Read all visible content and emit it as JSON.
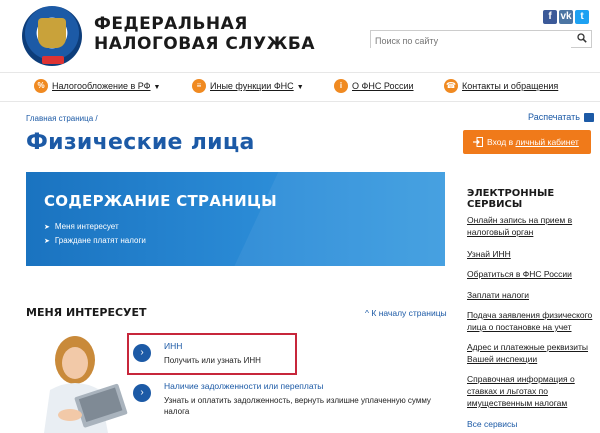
{
  "brand": {
    "line1": "ФЕДЕРАЛЬНАЯ",
    "line2": "НАЛОГОВАЯ СЛУЖБА"
  },
  "social": {
    "fb": "f",
    "vk": "vk",
    "tw": "t"
  },
  "search": {
    "placeholder": "Поиск по сайту"
  },
  "nav": {
    "items": [
      {
        "label": "Налогообложение в РФ",
        "icon": "%"
      },
      {
        "label": "Иные функции ФНС",
        "icon": "≡"
      },
      {
        "label": "О ФНС России",
        "icon": "i"
      },
      {
        "label": "Контакты и обращения",
        "icon": "☎"
      }
    ]
  },
  "breadcrumb": "Главная страница",
  "print_label": "Распечатать",
  "page_title": "Физические лица",
  "cabinet": {
    "prefix": "Вход в",
    "link": "личный кабинет"
  },
  "banner": {
    "title": "СОДЕРЖАНИЕ СТРАНИЦЫ",
    "links": [
      "Меня интересует",
      "Граждане платят налоги"
    ]
  },
  "section": {
    "title": "МЕНЯ ИНТЕРЕСУЕТ",
    "to_top": "К началу страницы",
    "items": [
      {
        "title": "ИНН",
        "desc": "Получить или узнать ИНН"
      },
      {
        "title": "Наличие задолженности или переплаты",
        "desc": "Узнать и оплатить задолженность, вернуть излишне уплаченную сумму налога"
      }
    ]
  },
  "sidebar": {
    "title": "ЭЛЕКТРОННЫЕ СЕРВИСЫ",
    "links": [
      "Онлайн запись на прием в налоговый орган",
      "Узнай ИНН",
      "Обратиться в ФНС России",
      "Заплати налоги",
      "Подача заявления физического лица о постановке на учет",
      "Адрес и платежные реквизиты Вашей инспекции",
      "Справочная информация о ставках и льготах по имущественным налогам"
    ],
    "all": "Все сервисы"
  },
  "colors": {
    "accent": "#1c5aa6",
    "orange": "#f07a1a",
    "highlight": "#c7263b"
  }
}
